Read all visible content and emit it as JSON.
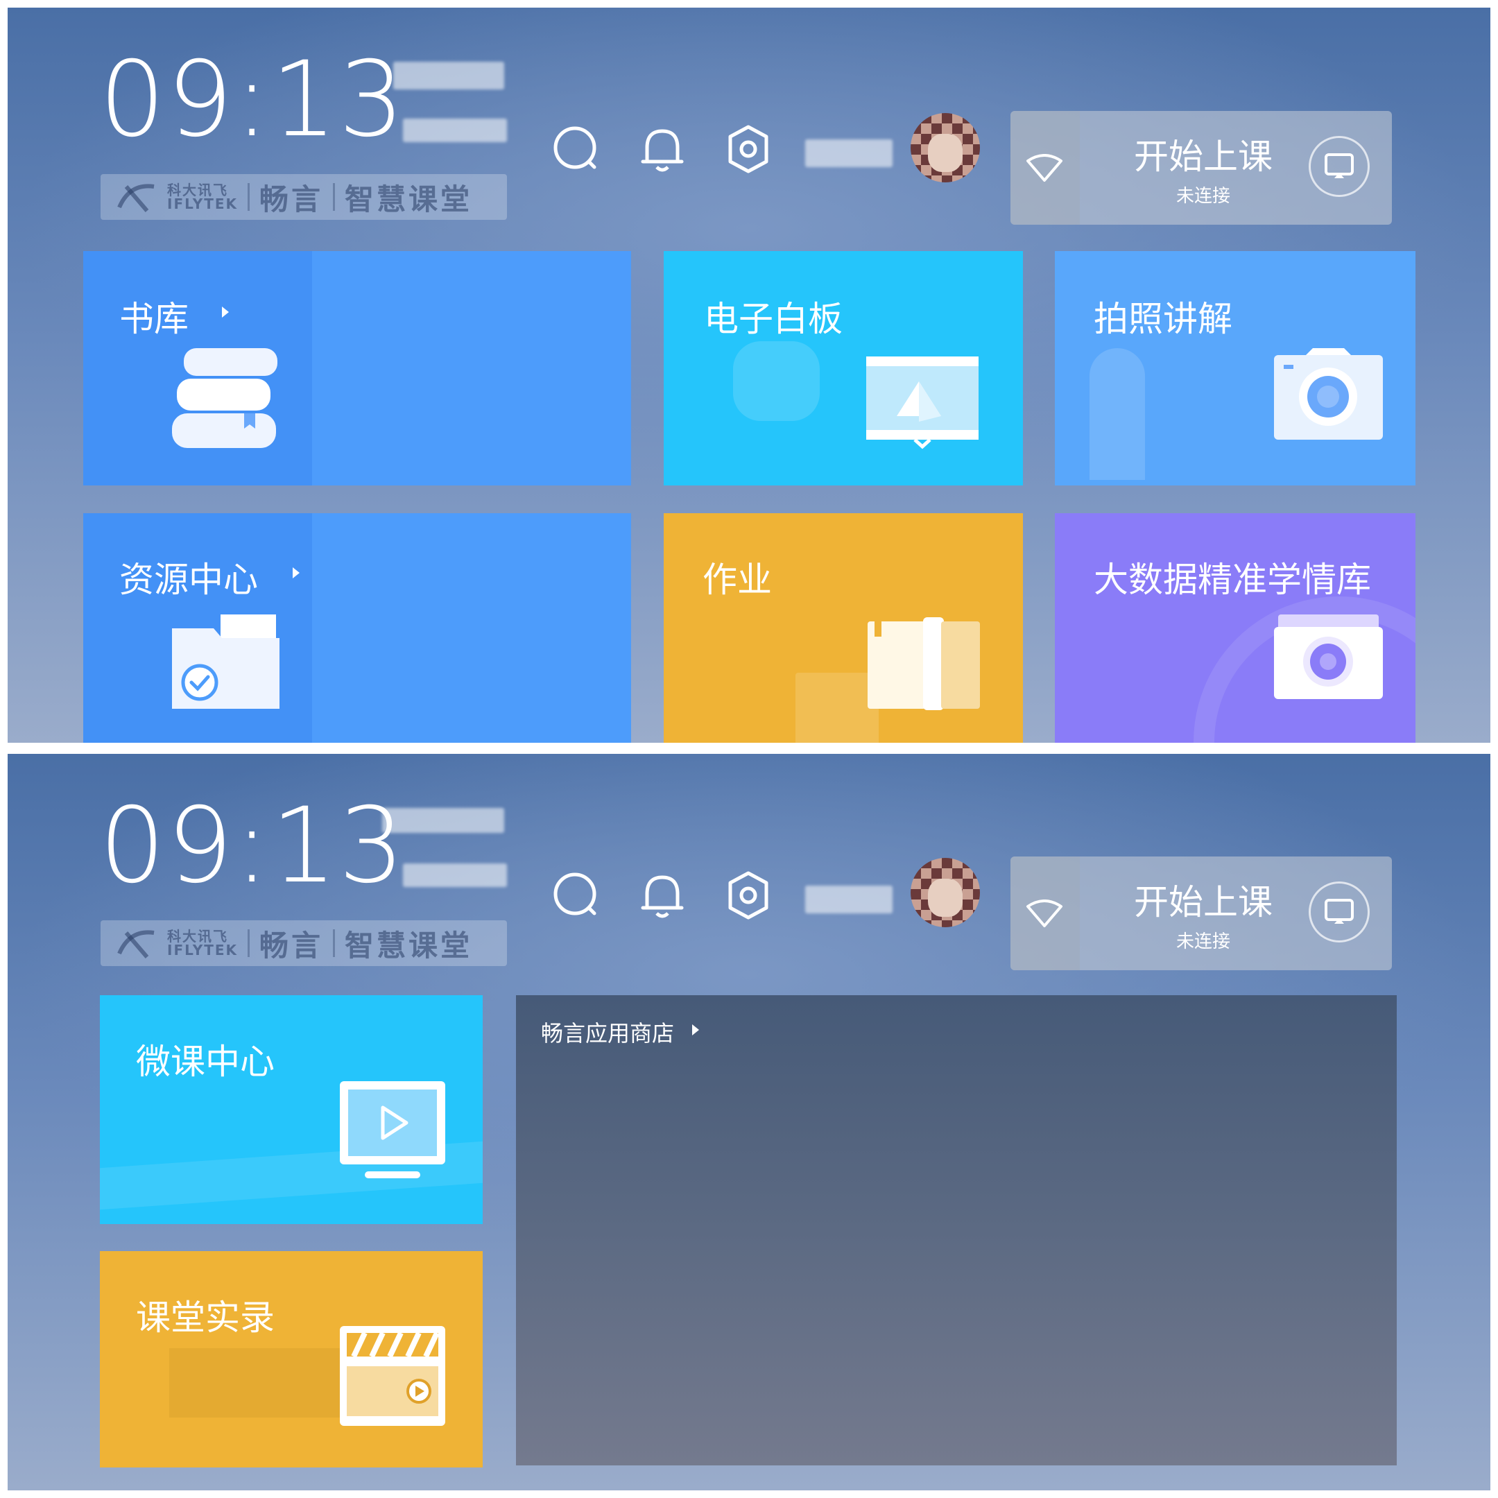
{
  "screens": [
    {
      "clock": "09:13",
      "brand": {
        "line1": "科大讯飞",
        "line2": "IFLYTEK",
        "name1": "畅言",
        "name2": "智慧课堂"
      },
      "start_class": {
        "title": "开始上课",
        "status": "未连接"
      },
      "tiles": {
        "library": "书库",
        "whiteboard": "电子白板",
        "photo_explain": "拍照讲解",
        "resource_center": "资源中心",
        "homework": "作业",
        "big_data": "大数据精准学情库"
      }
    },
    {
      "clock": "09:13",
      "brand": {
        "line1": "科大讯飞",
        "line2": "IFLYTEK",
        "name1": "畅言",
        "name2": "智慧课堂"
      },
      "start_class": {
        "title": "开始上课",
        "status": "未连接"
      },
      "tiles": {
        "micro_course": "微课中心",
        "classroom_record": "课堂实录",
        "app_store": "畅言应用商店"
      }
    }
  ],
  "colors": {
    "blue_tile": "#4d9cfb",
    "cyan_tile": "#25c5fb",
    "light_blue_tile": "#59a7fb",
    "yellow_tile": "#efb336",
    "purple_tile": "#8a7cf8"
  },
  "icons": [
    "search-icon",
    "bell-icon",
    "gear-icon",
    "wifi-icon",
    "cast-icon",
    "books-icon",
    "whiteboard-icon",
    "camera-icon",
    "folder-icon",
    "notebook-icon",
    "video-icon",
    "clapper-icon"
  ]
}
